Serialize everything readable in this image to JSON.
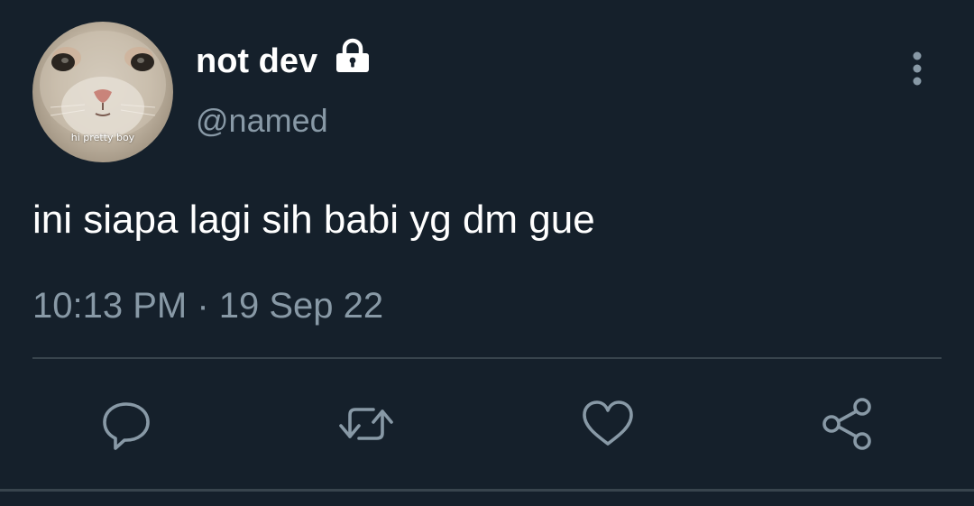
{
  "tweet": {
    "display_name": "not dev",
    "handle": "@named",
    "avatar_caption": "hi pretty boy",
    "text": "ini siapa lagi sih babi yg dm gue",
    "timestamp": "10:13 PM · 19 Sep 22"
  },
  "icons": {
    "protected": "lock-icon",
    "more": "more-vertical-icon",
    "reply": "reply-icon",
    "retweet": "retweet-icon",
    "like": "heart-icon",
    "share": "share-icon"
  },
  "colors": {
    "background": "#15202b",
    "primary_text": "#ffffff",
    "secondary_text": "#8899a6",
    "divider": "#38444d"
  }
}
